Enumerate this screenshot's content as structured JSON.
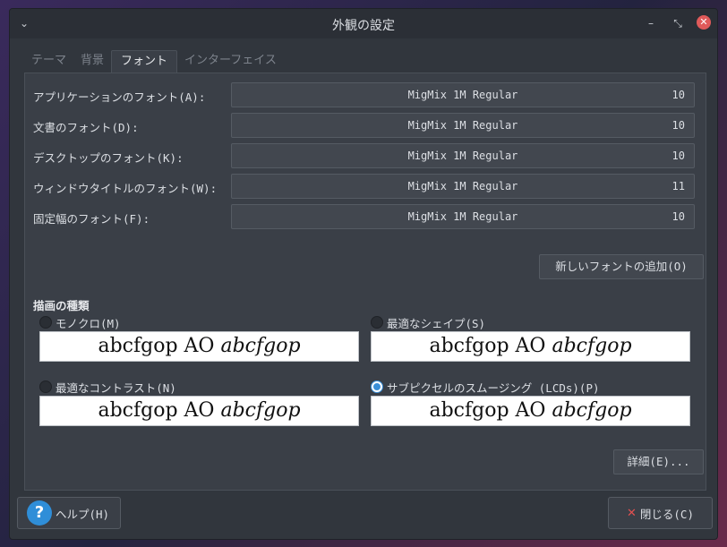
{
  "window": {
    "title": "外観の設定",
    "menu_icon": "chevron-down-icon",
    "minimize_icon": "minimize-icon",
    "maximize_icon": "maximize-icon",
    "close_icon": "close-icon"
  },
  "tabs": [
    {
      "label": "テーマ",
      "active": false
    },
    {
      "label": "背景",
      "active": false
    },
    {
      "label": "フォント",
      "active": true
    },
    {
      "label": "インターフェイス",
      "active": false
    }
  ],
  "fonts": [
    {
      "label": "アプリケーションのフォント(A):",
      "font": "MigMix 1M Regular",
      "size": "10"
    },
    {
      "label": "文書のフォント(D):",
      "font": "MigMix 1M Regular",
      "size": "10"
    },
    {
      "label": "デスクトップのフォント(K):",
      "font": "MigMix 1M Regular",
      "size": "10"
    },
    {
      "label": "ウィンドウタイトルのフォント(W):",
      "font": "MigMix 1M Regular",
      "size": "11"
    },
    {
      "label": "固定幅のフォント(F):",
      "font": "MigMix 1M Regular",
      "size": "10"
    }
  ],
  "add_font_label": "新しいフォントの追加(O)",
  "rendering": {
    "title": "描画の種類",
    "options": [
      {
        "label": "モノクロ(M)",
        "checked": false,
        "preview_regular": "abcfgop AO",
        "preview_italic": "abcfgop"
      },
      {
        "label": "最適なシェイプ(S)",
        "checked": false,
        "preview_regular": "abcfgop AO",
        "preview_italic": "abcfgop"
      },
      {
        "label": "最適なコントラスト(N)",
        "checked": false,
        "preview_regular": "abcfgop AO",
        "preview_italic": "abcfgop"
      },
      {
        "label": "サブピクセルのスムージング (LCDs)(P)",
        "checked": true,
        "preview_regular": "abcfgop AO",
        "preview_italic": "abcfgop"
      }
    ]
  },
  "details_label": "詳細(E)...",
  "help": {
    "label": "ヘルプ(H)",
    "icon": "help-icon",
    "icon_glyph": "?"
  },
  "close": {
    "label": "閉じる(C)",
    "icon": "close-x-icon",
    "icon_glyph": "✕"
  },
  "colors": {
    "accent": "#3a8fd8",
    "window_bg": "#31363d",
    "panel_bg": "#3a3f47",
    "close_red": "#e05a5a"
  }
}
